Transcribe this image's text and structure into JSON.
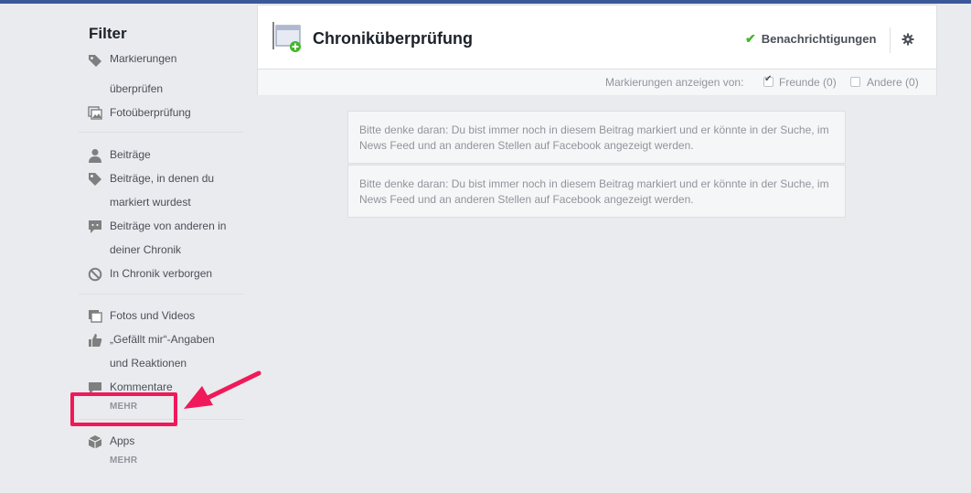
{
  "sidebar": {
    "title": "Filter",
    "items": [
      {
        "label": "Markierungen",
        "icon": "tag-icon"
      },
      {
        "label": "überprüfen"
      },
      {
        "label": "Fotoüberprüfung",
        "icon": "photo-review-icon"
      },
      {
        "label": "Beiträge",
        "icon": "person-icon"
      },
      {
        "label": "Beiträge, in denen du",
        "icon": "tag-icon"
      },
      {
        "label": "markiert wurdest"
      },
      {
        "label": "Beiträge von anderen in",
        "icon": "speech-bubble-icon"
      },
      {
        "label": "deiner Chronik"
      },
      {
        "label": "In Chronik verborgen",
        "icon": "hidden-icon"
      },
      {
        "label": "Fotos und Videos",
        "icon": "photos-icon"
      },
      {
        "label": "„Gefällt mir“-Angaben",
        "icon": "like-icon"
      },
      {
        "label": "und Reaktionen"
      },
      {
        "label": "Kommentare",
        "icon": "comment-icon"
      },
      {
        "label": "Apps",
        "icon": "box-icon"
      }
    ],
    "more_label_1": "MEHR",
    "more_label_2": "MEHR"
  },
  "header": {
    "title": "Chroniküberprüfung",
    "notifications_label": "Benachrichtigungen",
    "icon": "gear-icon"
  },
  "filter_bar": {
    "label": "Markierungen anzeigen von:",
    "friends": {
      "label": "Freunde (0)",
      "checked": true
    },
    "others": {
      "label": "Andere (0)",
      "checked": false
    }
  },
  "notices": [
    {
      "text": "Bitte denke daran: Du bist immer noch in diesem Beitrag markiert und er könnte in der Suche, im News Feed und an anderen Stellen auf Facebook angezeigt werden."
    },
    {
      "text": "Bitte denke daran: Du bist immer noch in diesem Beitrag markiert und er könnte in der Suche, im News Feed und an anderen Stellen auf Facebook angezeigt werden."
    }
  ],
  "colors": {
    "accent": "#3b5998",
    "highlight": "#f0195a",
    "check": "#42b72a"
  }
}
